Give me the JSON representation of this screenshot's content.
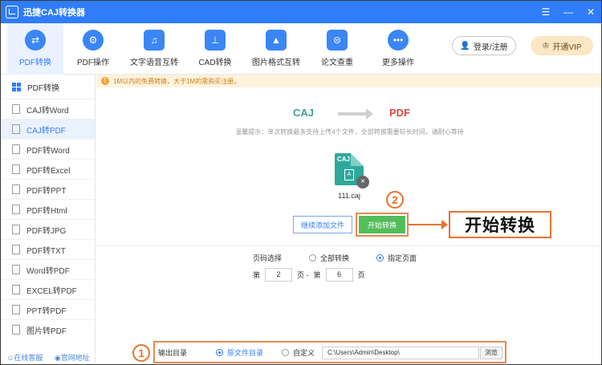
{
  "app": {
    "title": "迅捷CAJ转换器"
  },
  "window_controls": [
    "☰",
    "—",
    "✕"
  ],
  "topnav": [
    {
      "label": "PDF转换",
      "icon": "convert-icon",
      "glyph": "⇄",
      "active": true
    },
    {
      "label": "PDF操作",
      "icon": "gear-icon",
      "glyph": "⚙",
      "active": false
    },
    {
      "label": "文字语音互转",
      "icon": "speech-icon",
      "glyph": "♫",
      "active": false
    },
    {
      "label": "CAD转换",
      "icon": "cad-icon",
      "glyph": "⊥",
      "active": false
    },
    {
      "label": "图片格式互转",
      "icon": "image-icon",
      "glyph": "▲",
      "active": false
    },
    {
      "label": "论文查重",
      "icon": "search-doc-icon",
      "glyph": "⊜",
      "active": false
    },
    {
      "label": "更多操作",
      "icon": "more-icon",
      "glyph": "•••",
      "active": false
    }
  ],
  "login": {
    "label": "登录/注册"
  },
  "vip": {
    "label": "开通VIP"
  },
  "sidebar": {
    "header": "PDF转换",
    "items": [
      {
        "label": "CAJ转Word",
        "active": false
      },
      {
        "label": "CAJ转PDF",
        "active": true
      },
      {
        "label": "PDF转Word",
        "active": false
      },
      {
        "label": "PDF转Excel",
        "active": false
      },
      {
        "label": "PDF转PPT",
        "active": false
      },
      {
        "label": "PDF转Html",
        "active": false
      },
      {
        "label": "PDF转JPG",
        "active": false
      },
      {
        "label": "PDF转TXT",
        "active": false
      },
      {
        "label": "Word转PDF",
        "active": false
      },
      {
        "label": "EXCEL转PDF",
        "active": false
      },
      {
        "label": "PPT转PDF",
        "active": false
      },
      {
        "label": "图片转PDF",
        "active": false
      }
    ],
    "footer": {
      "service": "在线客服",
      "website": "官网地址"
    }
  },
  "notice": "1M以内的免费转换，大于1M的需购买注册。",
  "conversion": {
    "from": "CAJ",
    "to": "PDF"
  },
  "hint": "温馨提示：单次转换最多支持上传4个文件，全部转换需要较长时间，请耐心等待",
  "file": {
    "type": "CAJ",
    "glyph": "A",
    "name": "111.caj"
  },
  "actions": {
    "add_files": "继续添加文件",
    "start": "开始转换"
  },
  "callout": {
    "num2": "2",
    "num1": "1",
    "big_label": "开始转换"
  },
  "page_select": {
    "label": "页码选择",
    "option_all": "全部转换",
    "option_range": "指定页面",
    "selected": "指定页面",
    "from_prefix": "第",
    "from_value": "2",
    "from_suffix": "页 -",
    "to_prefix": "第",
    "to_value": "6",
    "to_suffix": "页"
  },
  "output": {
    "label": "输出目录",
    "option_source": "原文件目录",
    "option_custom": "自定义",
    "selected": "原文件目录",
    "path": "C:\\Users\\Admin\\Desktop\\",
    "browse": "浏览"
  },
  "colors": {
    "brand": "#2f7dfa",
    "accent": "#e8732e",
    "start_green": "#53bd5a"
  }
}
